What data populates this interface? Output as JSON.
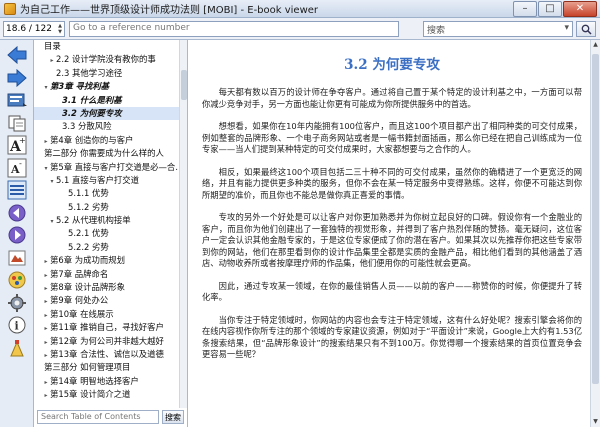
{
  "window": {
    "title": "为自己工作——世界顶级设计师成功法则 [MOBI] - E-book viewer",
    "minimize": "–",
    "maximize": "□",
    "close": "✕"
  },
  "toolbar": {
    "position": "18.6 / 122",
    "reference_placeholder": "Go to a reference number",
    "search_placeholder": "搜索",
    "search_dropdown": "▾"
  },
  "left_tools": [
    {
      "name": "back-icon"
    },
    {
      "name": "forward-icon"
    },
    {
      "name": "open-book-icon"
    },
    {
      "name": "copy-icon"
    },
    {
      "name": "font-larger-icon"
    },
    {
      "name": "font-smaller-icon"
    },
    {
      "name": "toc-list-icon"
    },
    {
      "name": "previous-page-icon"
    },
    {
      "name": "next-page-icon"
    },
    {
      "name": "dictionary-icon"
    },
    {
      "name": "theme-icon"
    },
    {
      "name": "preferences-icon"
    },
    {
      "name": "metadata-icon"
    },
    {
      "name": "bookmark-icon"
    }
  ],
  "toc": {
    "items": [
      {
        "label": "目录",
        "indent": 0,
        "arrow": ""
      },
      {
        "label": "2.2 设计学院没有教你的事",
        "indent": 2,
        "arrow": "▸"
      },
      {
        "label": "2.3 其他学习途径",
        "indent": 2,
        "arrow": ""
      },
      {
        "label": "第3章 寻找利基",
        "indent": 1,
        "arrow": "▾",
        "bold": true
      },
      {
        "label": "3.1 什么是利基",
        "indent": 3,
        "arrow": "",
        "bold": true
      },
      {
        "label": "3.2 为何要专攻",
        "indent": 3,
        "arrow": "",
        "bold": true,
        "selected": true
      },
      {
        "label": "3.3 分散风险",
        "indent": 3,
        "arrow": ""
      },
      {
        "label": "第4章 创造你的与客户",
        "indent": 1,
        "arrow": "▸"
      },
      {
        "label": "第二部分 你需要成为什么样的人",
        "indent": 0,
        "arrow": ""
      },
      {
        "label": "第5章 直接与客户打交道是必—合…",
        "indent": 1,
        "arrow": "▾"
      },
      {
        "label": "5.1 直接与客户打交道",
        "indent": 2,
        "arrow": "▾"
      },
      {
        "label": "5.1.1 优势",
        "indent": 4,
        "arrow": ""
      },
      {
        "label": "5.1.2 劣势",
        "indent": 4,
        "arrow": ""
      },
      {
        "label": "5.2 从代理机构接单",
        "indent": 2,
        "arrow": "▾"
      },
      {
        "label": "5.2.1 优势",
        "indent": 4,
        "arrow": ""
      },
      {
        "label": "5.2.2 劣势",
        "indent": 4,
        "arrow": ""
      },
      {
        "label": "第6章 为成功而规划",
        "indent": 1,
        "arrow": "▸"
      },
      {
        "label": "第7章 品牌命名",
        "indent": 1,
        "arrow": "▸"
      },
      {
        "label": "第8章 设计品牌形象",
        "indent": 1,
        "arrow": "▸"
      },
      {
        "label": "第9章 何处办公",
        "indent": 1,
        "arrow": "▸"
      },
      {
        "label": "第10章 在线展示",
        "indent": 1,
        "arrow": "▸"
      },
      {
        "label": "第11章 推销自己，寻找好客户",
        "indent": 1,
        "arrow": "▸"
      },
      {
        "label": "第12章 为何公司并非越大越好",
        "indent": 1,
        "arrow": "▸"
      },
      {
        "label": "第13章 合法性、诚信以及道德",
        "indent": 1,
        "arrow": "▸"
      },
      {
        "label": "第三部分 如何管理项目",
        "indent": 0,
        "arrow": ""
      },
      {
        "label": "第14章 明智地选择客户",
        "indent": 1,
        "arrow": "▸"
      },
      {
        "label": "第15章 设计简介之道",
        "indent": 1,
        "arrow": "▸"
      }
    ],
    "search_placeholder": "Search Table of Contents",
    "search_button": "搜索"
  },
  "content": {
    "chapter_title": "3.2 为何要专攻",
    "paragraphs": [
      "每天都有数以百万的设计师在争夺客户。通过将自己置于某个特定的设计利基之中，一方面可以帮你减少竞争对手，另一方面也能让你更有可能成为你所提供服务中的首选。",
      "想想看，如果你在10年内能拥有100位客户，而且这100个项目都产出了相同种类的可交付成果，例如整套的品牌形象、一个电子商务网站或者是一幅书籍封面插画，那么你已经在把自己训练成为一位专家——当人们提到某种特定的可交付成果时，大家都想要与之合作的人。",
      "相反，如果最终这100个项目包括二三十种不同的可交付成果，虽然你的确精进了一个更宽泛的网络，并且有能力提供更多种类的服务，但你不会在某一特定服务中变得熟练。这样，你便不可能达到你所期望的准价，而且你也不能总是做你真正喜爱的事情。",
      "专攻的另外一个好处是可以让客户对你更加熟悉并为你树立起良好的口碑。假设你有一个金融业的客户，而且你为他们创建出了一套独特的视觉形象，并得到了客户热烈伴随的赞扬。毫无疑问，这位客户一定会认识其他金融专家的，于是这位专家便成了你的潜在客户。如果其次以先推荐你把这些专家带到你的网站，他们在那里看到你的设计作品集里全都是实质的金融产品，相比他们看到的其他涵盖了酒店、动物收养所或者按摩理疗师的作品集，他们便用你的可能性就会更高。",
      "因此，通过专攻某一领域，在你的最佳销售人员——以前的客户——称赞你的时候，你便提升了转化率。",
      "当你专注于特定领域时，你网站的内容也会专注于特定领域，这有什么好处呢？搜索引擎会将你的在线内容视作你所专注的那个领域的专家建议资源，例如对于“平面设计”来说，Google上大约有1.53亿条搜索结果，但“品牌形象设计”的搜索结果只有不到100万。你觉得哪一个搜索结果的首页位置竞争会更容易一些呢？"
    ]
  }
}
